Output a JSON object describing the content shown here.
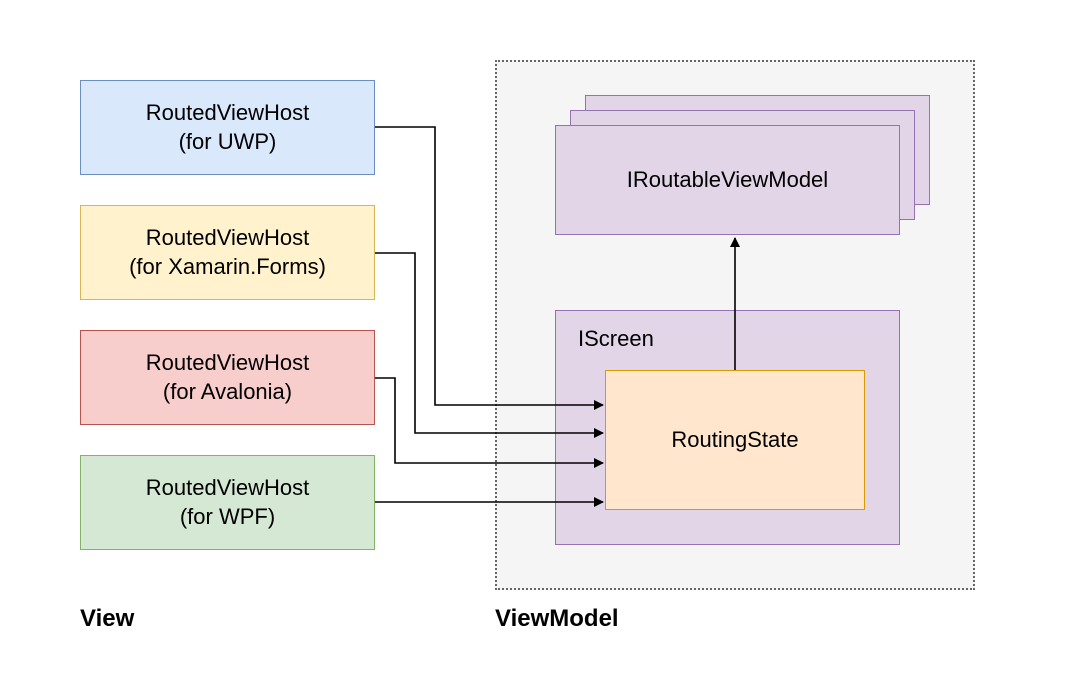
{
  "view": {
    "label": "View",
    "hosts": [
      {
        "line1": "RoutedViewHost",
        "line2": "(for UWP)",
        "fill": "#dae8fc",
        "stroke": "#6c8ebf"
      },
      {
        "line1": "RoutedViewHost",
        "line2": "(for Xamarin.Forms)",
        "fill": "#fff2cc",
        "stroke": "#d6b656"
      },
      {
        "line1": "RoutedViewHost",
        "line2": "(for Avalonia)",
        "fill": "#f8cecc",
        "stroke": "#b85450"
      },
      {
        "line1": "RoutedViewHost",
        "line2": "(for WPF)",
        "fill": "#d5e8d4",
        "stroke": "#82b366"
      }
    ]
  },
  "viewmodel": {
    "label": "ViewModel",
    "routable_label": "IRoutableViewModel",
    "iscreen_label": "IScreen",
    "routingstate_label": "RoutingState"
  },
  "colors": {
    "purple_fill": "#e1d5e7",
    "purple_stroke": "#9672b5",
    "orange_fill": "#ffe6cc",
    "orange_stroke": "#d79b00",
    "container_fill": "#f5f5f5",
    "container_stroke": "#666666"
  }
}
